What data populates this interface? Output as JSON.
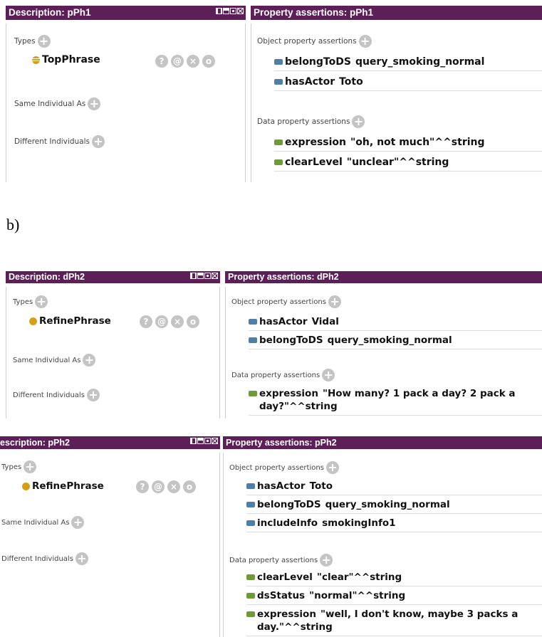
{
  "caption": "b)",
  "common": {
    "types_label": "Types",
    "same_label": "Same Individual As",
    "different_label": "Different Individuals",
    "object_label": "Object property assertions",
    "data_label": "Data property assertions",
    "add_glyph": "+",
    "ctrl_glyphs": [
      "?",
      "@",
      "×",
      "o"
    ]
  },
  "panel_a": {
    "desc_title": "Description: pPh1",
    "prop_title": "Property assertions: pPh1",
    "type_name": "TopPhrase",
    "object_props": [
      {
        "name": "belongToDS",
        "value": "query_smoking_normal"
      },
      {
        "name": "hasActor",
        "value": "Toto"
      }
    ],
    "data_props": [
      {
        "name": "expression",
        "value": "\"oh, not much\"^^string"
      },
      {
        "name": "clearLevel",
        "value": "\"unclear\"^^string"
      }
    ]
  },
  "panel_b": {
    "desc_title": "Description: dPh2",
    "prop_title": "Property assertions: dPh2",
    "type_name": "RefinePhrase",
    "object_props": [
      {
        "name": "hasActor",
        "value": "Vidal"
      },
      {
        "name": "belongToDS",
        "value": "query_smoking_normal"
      }
    ],
    "data_props": [
      {
        "name": "expression",
        "value": "\"How many? 1 pack a day? 2 pack a",
        "value2": "day?\"^^string"
      }
    ]
  },
  "panel_c": {
    "desc_title": "escription: pPh2",
    "prop_title": "Property assertions: pPh2",
    "type_name": "RefinePhrase",
    "object_props": [
      {
        "name": "hasActor",
        "value": "Toto"
      },
      {
        "name": "belongToDS",
        "value": "query_smoking_normal"
      },
      {
        "name": "includeInfo",
        "value": "smokingInfo1"
      }
    ],
    "data_props": [
      {
        "name": "clearLevel",
        "value": "\"clear\"^^string"
      },
      {
        "name": "dsStatus",
        "value": "\"normal\"^^string"
      },
      {
        "name": "expression",
        "value": "\"well, I don't know, maybe 3 packs a",
        "value2": "day.\"^^string"
      }
    ]
  },
  "colors": {
    "header": "#5c1f57",
    "object_property": "#4f7fa6",
    "data_property": "#6f9a3a",
    "individual": "#d4a017"
  }
}
